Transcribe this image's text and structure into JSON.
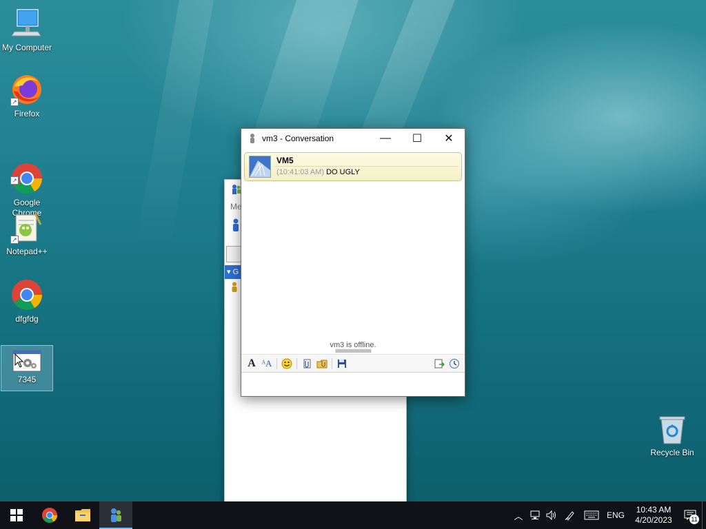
{
  "desktop": {
    "icons": [
      {
        "label": "My Computer"
      },
      {
        "label": "Firefox"
      },
      {
        "label": "Google\nChrome"
      },
      {
        "label": "Notepad++"
      },
      {
        "label": "dfgfdg"
      },
      {
        "label": "7345"
      },
      {
        "label": "Recycle Bin"
      }
    ]
  },
  "background_window": {
    "snippet": "Me",
    "group_letter": "G"
  },
  "conversation": {
    "title": "vm3 - Conversation",
    "message": {
      "sender": "VM5",
      "time": "(10:41:03 AM)",
      "text": "DO UGLY"
    },
    "status": "vm3 is offline."
  },
  "taskbar": {
    "language": "ENG",
    "time": "10:43 AM",
    "date": "4/20/2023",
    "notification_count": "11"
  },
  "colors": {
    "bubble_border": "#c9c28c",
    "taskbar": "#0f1116",
    "accent": "#76b9ed"
  }
}
